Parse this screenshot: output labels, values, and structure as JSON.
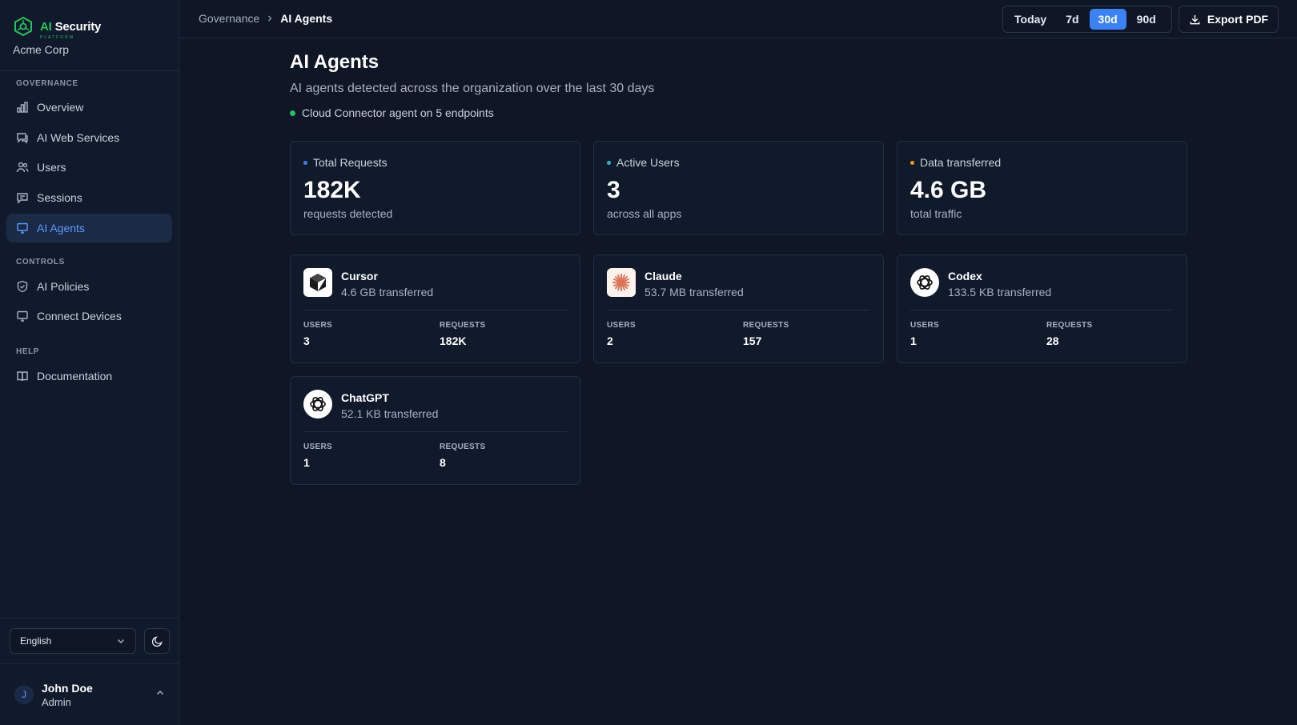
{
  "brand": {
    "name_prefix": "AI",
    "name_suffix": "Security",
    "tagline": "PLATFORM",
    "org": "Acme Corp"
  },
  "sidebar": {
    "sections": [
      {
        "label": "GOVERNANCE"
      },
      {
        "label": "CONTROLS"
      },
      {
        "label": "HELP"
      }
    ],
    "items": [
      {
        "label": "Overview",
        "icon": "bar-chart-icon"
      },
      {
        "label": "AI Web Services",
        "icon": "chat-icon"
      },
      {
        "label": "Users",
        "icon": "users-icon"
      },
      {
        "label": "Sessions",
        "icon": "message-icon"
      },
      {
        "label": "AI Agents",
        "icon": "monitor-icon",
        "active": true
      },
      {
        "label": "AI Policies",
        "icon": "shield-icon"
      },
      {
        "label": "Connect Devices",
        "icon": "monitor-icon"
      },
      {
        "label": "Documentation",
        "icon": "book-icon"
      }
    ],
    "language": "English",
    "user": {
      "initial": "J",
      "name": "John Doe",
      "role": "Admin"
    }
  },
  "topbar": {
    "breadcrumb": [
      "Governance",
      "AI Agents"
    ],
    "ranges": [
      "Today",
      "7d",
      "30d",
      "90d"
    ],
    "active_range": "30d",
    "export_label": "Export PDF"
  },
  "page": {
    "title": "AI Agents",
    "subtitle": "AI agents detected across the organization over the last 30 days",
    "status": "Cloud Connector agent on 5 endpoints"
  },
  "stats": [
    {
      "label": "Total Requests",
      "value": "182K",
      "caption": "requests detected",
      "dot_color": "#3b82f6"
    },
    {
      "label": "Active Users",
      "value": "3",
      "caption": "across all apps",
      "dot_color": "#22b8cf"
    },
    {
      "label": "Data transferred",
      "value": "4.6 GB",
      "caption": "total traffic",
      "dot_color": "#f59e0b"
    }
  ],
  "agents": [
    {
      "name": "Cursor",
      "transfer": "4.6 GB transferred",
      "users_label": "USERS",
      "users": "3",
      "requests_label": "REQUESTS",
      "requests": "182K",
      "icon": "cursor-logo-icon"
    },
    {
      "name": "Claude",
      "transfer": "53.7 MB transferred",
      "users_label": "USERS",
      "users": "2",
      "requests_label": "REQUESTS",
      "requests": "157",
      "icon": "claude-logo-icon"
    },
    {
      "name": "Codex",
      "transfer": "133.5 KB transferred",
      "users_label": "USERS",
      "users": "1",
      "requests_label": "REQUESTS",
      "requests": "28",
      "icon": "openai-logo-icon"
    },
    {
      "name": "ChatGPT",
      "transfer": "52.1 KB transferred",
      "users_label": "USERS",
      "users": "1",
      "requests_label": "REQUESTS",
      "requests": "8",
      "icon": "openai-logo-icon"
    }
  ],
  "colors": {
    "accent": "#3b82f6",
    "status_ok": "#22c55e",
    "background": "#0f1626"
  }
}
